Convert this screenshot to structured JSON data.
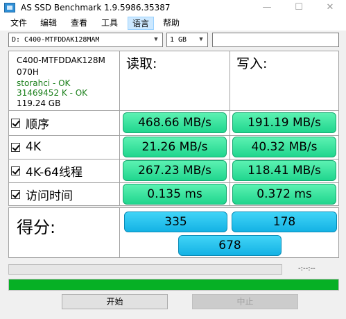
{
  "window": {
    "title": "AS SSD Benchmark 1.9.5986.35387"
  },
  "menu": [
    "文件",
    "编辑",
    "查看",
    "工具",
    "语言",
    "帮助"
  ],
  "drive_select": {
    "value": "D: C400-MTFDDAK128MAM"
  },
  "size_select": {
    "value": "1 GB"
  },
  "info": {
    "model_line1": "C400-MTFDDAK128M",
    "model_line2": "070H",
    "driver": "storahci - OK",
    "alignment": "31469452 K - OK",
    "capacity": "119.24 GB"
  },
  "columns": {
    "read": "读取:",
    "write": "写入:"
  },
  "rows": [
    {
      "label": "顺序",
      "read": "468.66 MB/s",
      "write": "191.19 MB/s"
    },
    {
      "label": "4K",
      "read": "21.26 MB/s",
      "write": "40.32 MB/s"
    },
    {
      "label": "4K-64线程",
      "read": "267.23 MB/s",
      "write": "118.41 MB/s"
    },
    {
      "label": "访问时间",
      "read": "0.135 ms",
      "write": "0.372 ms"
    }
  ],
  "score": {
    "label": "得分:",
    "read": "335",
    "write": "178",
    "total": "678"
  },
  "status": {
    "time": "-:--:--",
    "progress_fraction": 1.0
  },
  "buttons": {
    "start": "开始",
    "abort": "中止"
  },
  "colors": {
    "result_green": "#20d68e",
    "score_blue": "#14b2e4",
    "progress_green": "#06b025"
  }
}
